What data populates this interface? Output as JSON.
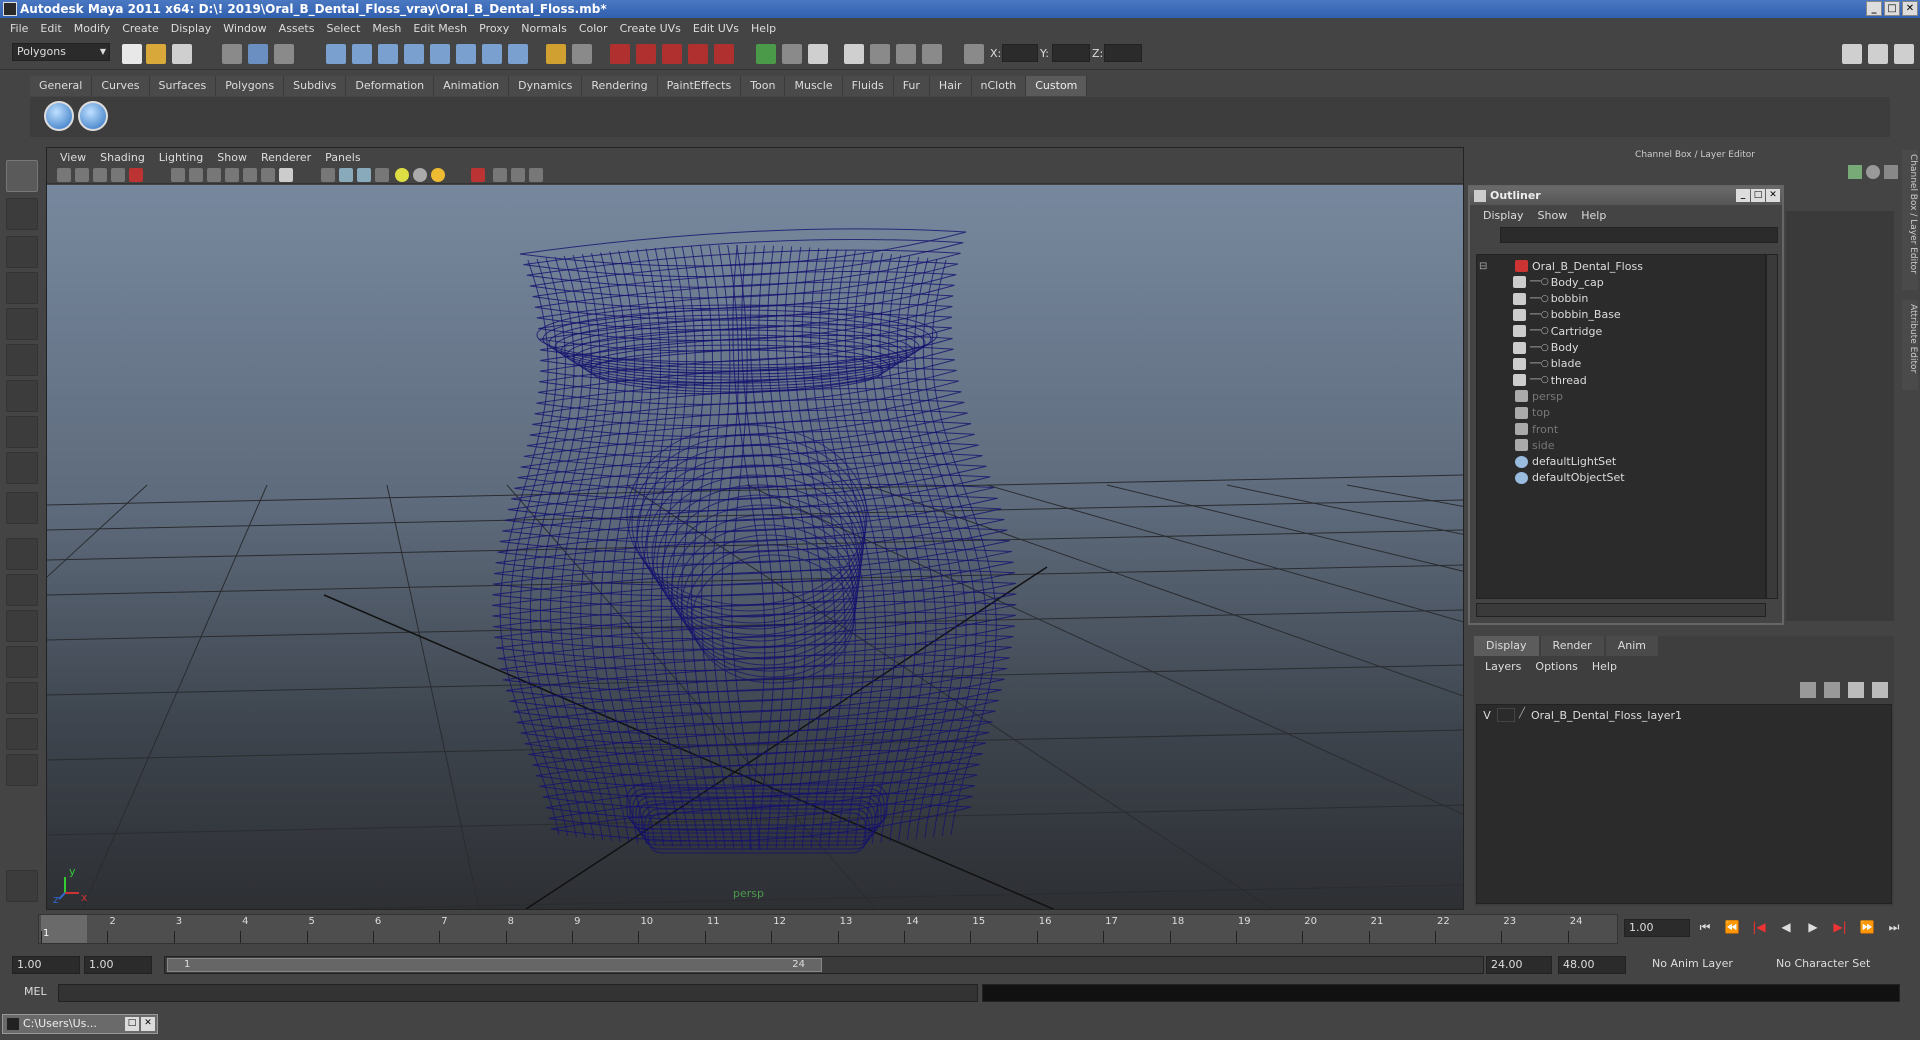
{
  "title": "Autodesk Maya 2011 x64: D:\\! 2019\\Oral_B_Dental_Floss_vray\\Oral_B_Dental_Floss.mb*",
  "menu": [
    "File",
    "Edit",
    "Modify",
    "Create",
    "Display",
    "Window",
    "Assets",
    "Select",
    "Mesh",
    "Edit Mesh",
    "Proxy",
    "Normals",
    "Color",
    "Create UVs",
    "Edit UVs",
    "Help"
  ],
  "module_selector": "Polygons",
  "xyz": {
    "x": "X:",
    "y": "Y:",
    "z": "Z:"
  },
  "shelf_tabs": [
    "General",
    "Curves",
    "Surfaces",
    "Polygons",
    "Subdivs",
    "Deformation",
    "Animation",
    "Dynamics",
    "Rendering",
    "PaintEffects",
    "Toon",
    "Muscle",
    "Fluids",
    "Fur",
    "Hair",
    "nCloth",
    "Custom"
  ],
  "active_shelf": "Custom",
  "viewport": {
    "menu": [
      "View",
      "Shading",
      "Lighting",
      "Show",
      "Renderer",
      "Panels"
    ],
    "camera": "persp",
    "axis": {
      "x": "x",
      "y": "y",
      "z": "z"
    },
    "wire_color": "#14106e"
  },
  "channel_box_title": "Channel Box / Layer Editor",
  "side_tabs": [
    "Channel Box / Layer Editor",
    "Attribute Editor"
  ],
  "outliner": {
    "title": "Outliner",
    "menu": [
      "Display",
      "Show",
      "Help"
    ],
    "items": [
      {
        "label": "Oral_B_Dental_Floss",
        "level": 0,
        "dim": false,
        "icon": "transform-icon"
      },
      {
        "label": "Body_cap",
        "level": 1,
        "dim": false,
        "icon": "mesh-icon"
      },
      {
        "label": "bobbin",
        "level": 1,
        "dim": false,
        "icon": "mesh-icon"
      },
      {
        "label": "bobbin_Base",
        "level": 1,
        "dim": false,
        "icon": "mesh-icon"
      },
      {
        "label": "Cartridge",
        "level": 1,
        "dim": false,
        "icon": "mesh-icon"
      },
      {
        "label": "Body",
        "level": 1,
        "dim": false,
        "icon": "mesh-icon"
      },
      {
        "label": "blade",
        "level": 1,
        "dim": false,
        "icon": "mesh-icon"
      },
      {
        "label": "thread",
        "level": 1,
        "dim": false,
        "icon": "mesh-icon"
      },
      {
        "label": "persp",
        "level": 0,
        "dim": true,
        "icon": "camera-icon"
      },
      {
        "label": "top",
        "level": 0,
        "dim": true,
        "icon": "camera-icon"
      },
      {
        "label": "front",
        "level": 0,
        "dim": true,
        "icon": "camera-icon"
      },
      {
        "label": "side",
        "level": 0,
        "dim": true,
        "icon": "camera-icon"
      },
      {
        "label": "defaultLightSet",
        "level": 0,
        "dim": false,
        "icon": "set-icon"
      },
      {
        "label": "defaultObjectSet",
        "level": 0,
        "dim": false,
        "icon": "set-icon"
      }
    ]
  },
  "layers": {
    "tabs": [
      "Display",
      "Render",
      "Anim"
    ],
    "menu": [
      "Layers",
      "Options",
      "Help"
    ],
    "rows": [
      {
        "visible": "V",
        "name": "Oral_B_Dental_Floss_layer1"
      }
    ]
  },
  "timeline": {
    "ticks": [
      "1",
      "2",
      "3",
      "4",
      "5",
      "6",
      "7",
      "8",
      "9",
      "10",
      "11",
      "12",
      "13",
      "14",
      "15",
      "16",
      "17",
      "18",
      "19",
      "20",
      "21",
      "22",
      "23",
      "24"
    ],
    "current_frame_marker": "1",
    "current_time": "1.00"
  },
  "range": {
    "start": "1.00",
    "playback_start": "1.00",
    "slider_start": "1",
    "slider_end": "24",
    "playback_end": "24.00",
    "end": "48.00",
    "anim_layer": "No Anim Layer",
    "character_set": "No Character Set"
  },
  "mel_label": "MEL",
  "taskbar_item": "C:\\Users\\Us..."
}
